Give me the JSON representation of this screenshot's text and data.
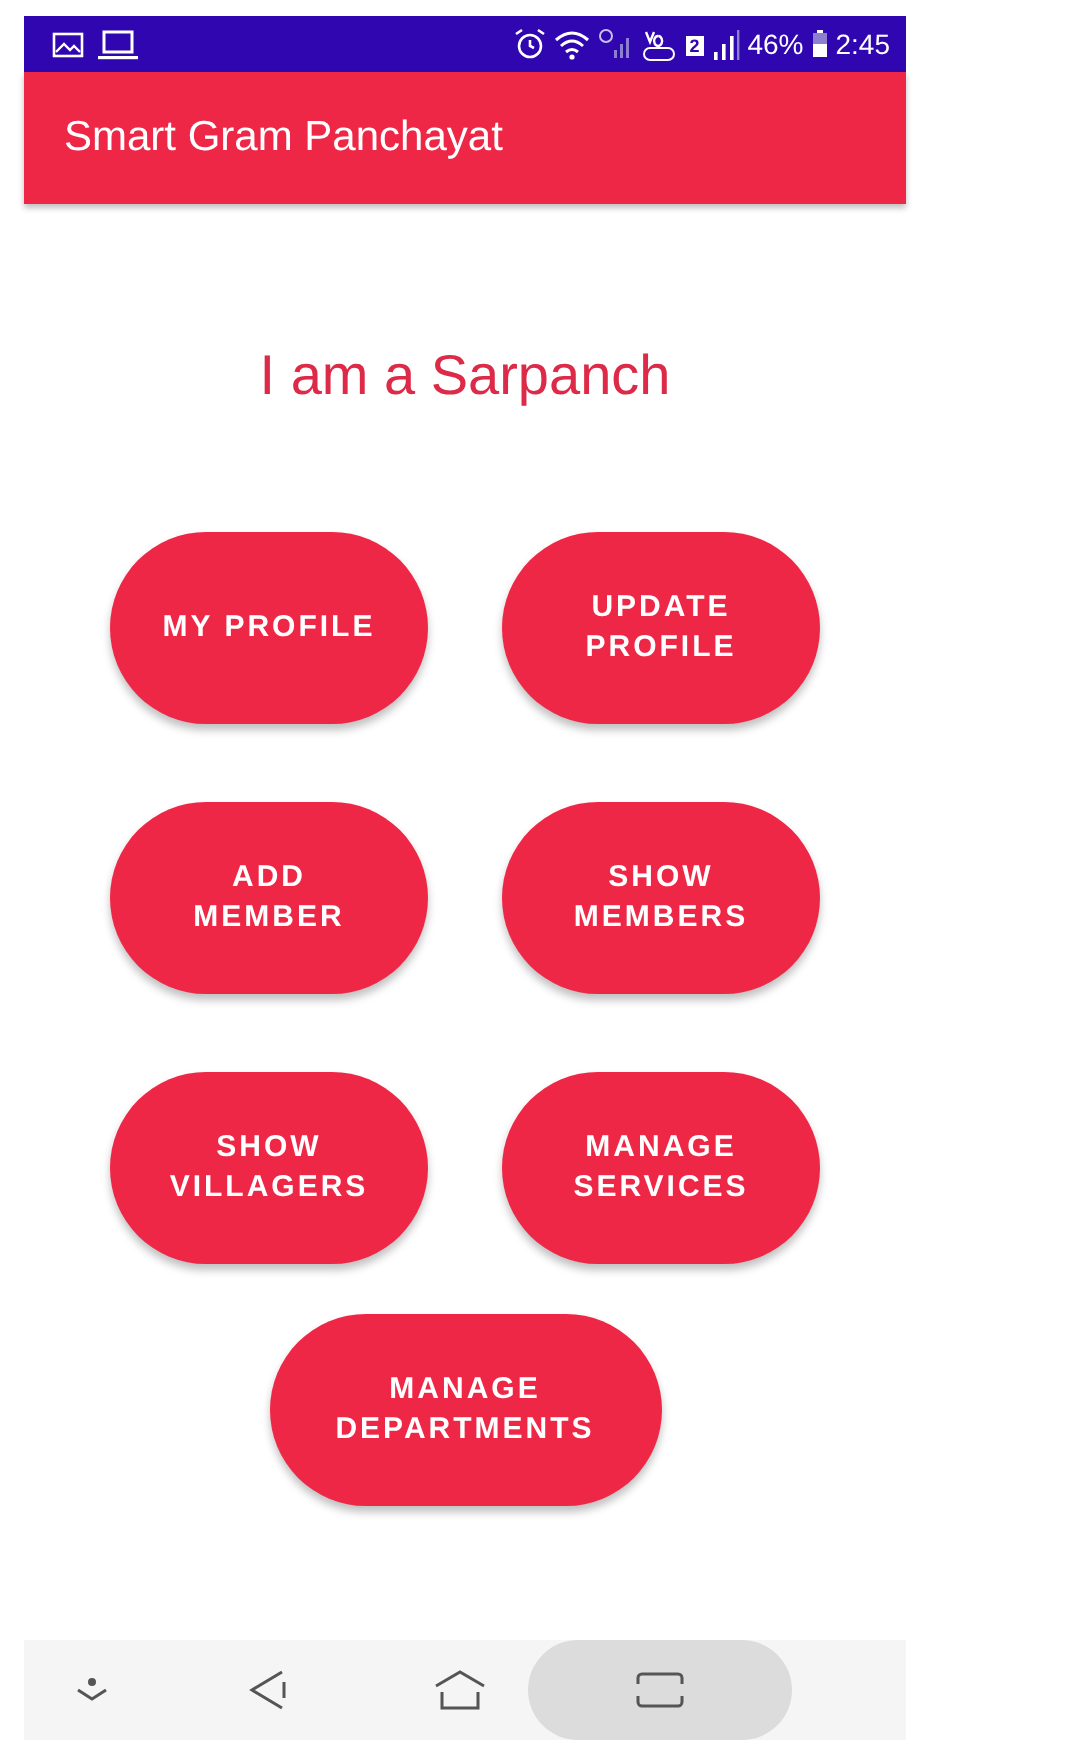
{
  "status_bar": {
    "sim_badge": "2",
    "battery": "46%",
    "time": "2:45"
  },
  "app_bar": {
    "title": "Smart Gram Panchayat"
  },
  "heading": "I am a Sarpanch",
  "buttons": [
    {
      "label": "MY PROFILE"
    },
    {
      "label": "UPDATE PROFILE"
    },
    {
      "label": "ADD MEMBER"
    },
    {
      "label": "SHOW MEMBERS"
    },
    {
      "label": "SHOW VILLAGERS"
    },
    {
      "label": "MANAGE SERVICES"
    },
    {
      "label": "MANAGE DEPARTMENTS"
    }
  ]
}
